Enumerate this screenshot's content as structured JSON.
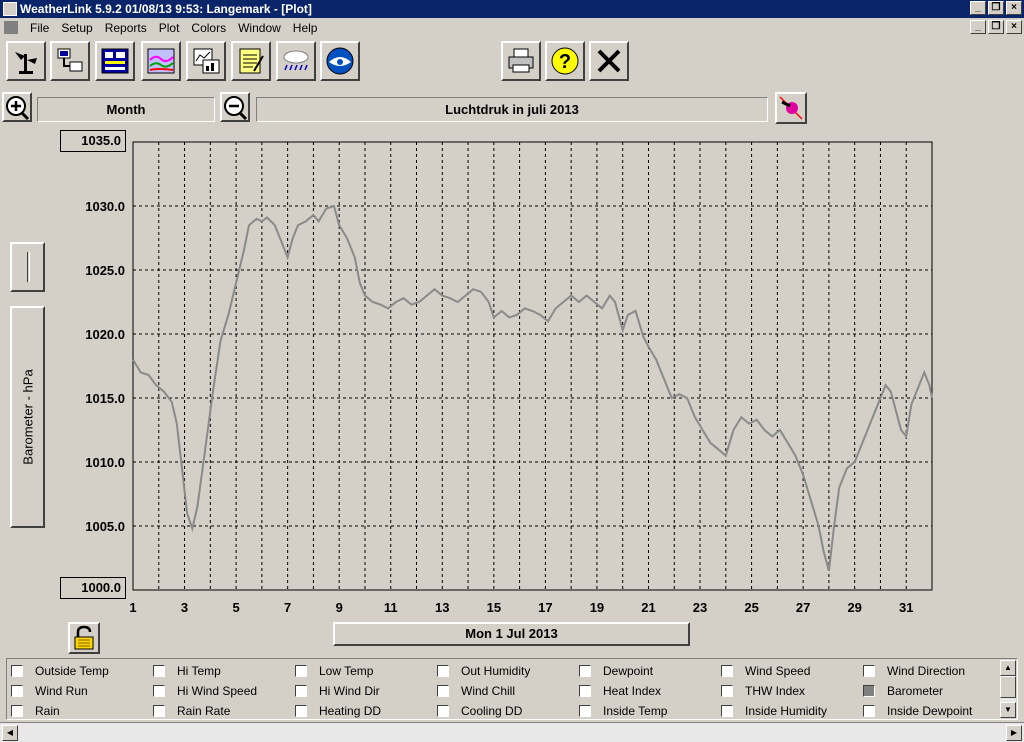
{
  "window": {
    "title": "WeatherLink 5.9.2  01/08/13  9:53: Langemark - [Plot]",
    "colors": {
      "titlebar": "#0a246a",
      "chrome": "#d4d0c8",
      "plot_line": "#8a8a8a"
    }
  },
  "menu": {
    "items": [
      "File",
      "Setup",
      "Reports",
      "Plot",
      "Colors",
      "Window",
      "Help"
    ]
  },
  "toolbar": {
    "icons": [
      "station-icon",
      "connect-icon",
      "bulletin-icon",
      "graph-icon",
      "plot-icon",
      "notes-icon",
      "weather-icon",
      "noaa-icon",
      "printer-icon",
      "help-icon",
      "close-icon"
    ]
  },
  "plot": {
    "zoom_period": "Month",
    "title": "Luchtdruk in juli 2013",
    "y_axis_label": "Barometer - hPa",
    "date_label": "Mon 1 Jul 2013"
  },
  "chart_data": {
    "type": "line",
    "title": "Luchtdruk in juli 2013",
    "xlabel": "",
    "ylabel": "Barometer - hPa",
    "ylim": [
      1000,
      1035
    ],
    "xlim": [
      1,
      32
    ],
    "y_ticks": [
      "1035.0",
      "1030.0",
      "1025.0",
      "1020.0",
      "1015.0",
      "1010.0",
      "1005.0",
      "1000.0"
    ],
    "x_ticks": [
      "1",
      "3",
      "5",
      "7",
      "9",
      "11",
      "13",
      "15",
      "17",
      "19",
      "21",
      "23",
      "25",
      "27",
      "29",
      "31"
    ],
    "grid": true,
    "series": [
      {
        "values": [
          [
            1.0,
            1018.0
          ],
          [
            1.3,
            1017.0
          ],
          [
            1.6,
            1016.8
          ],
          [
            1.9,
            1016.0
          ],
          [
            2.2,
            1015.5
          ],
          [
            2.5,
            1014.7
          ],
          [
            2.7,
            1013.0
          ],
          [
            2.9,
            1009.5
          ],
          [
            3.1,
            1006.0
          ],
          [
            3.3,
            1004.8
          ],
          [
            3.5,
            1006.5
          ],
          [
            3.8,
            1011.0
          ],
          [
            4.1,
            1015.5
          ],
          [
            4.4,
            1019.5
          ],
          [
            4.7,
            1021.5
          ],
          [
            5.0,
            1024.0
          ],
          [
            5.3,
            1026.5
          ],
          [
            5.5,
            1028.5
          ],
          [
            5.8,
            1029.0
          ],
          [
            6.0,
            1028.8
          ],
          [
            6.2,
            1029.1
          ],
          [
            6.5,
            1028.5
          ],
          [
            6.8,
            1027.0
          ],
          [
            7.0,
            1026.0
          ],
          [
            7.2,
            1027.5
          ],
          [
            7.4,
            1028.5
          ],
          [
            7.7,
            1028.8
          ],
          [
            8.0,
            1029.3
          ],
          [
            8.2,
            1028.8
          ],
          [
            8.5,
            1029.8
          ],
          [
            8.8,
            1030.0
          ],
          [
            9.0,
            1028.5
          ],
          [
            9.3,
            1027.5
          ],
          [
            9.6,
            1026.0
          ],
          [
            9.8,
            1024.0
          ],
          [
            10.0,
            1023.0
          ],
          [
            10.3,
            1022.5
          ],
          [
            10.6,
            1022.3
          ],
          [
            10.9,
            1022.0
          ],
          [
            11.2,
            1022.5
          ],
          [
            11.5,
            1022.8
          ],
          [
            11.8,
            1022.3
          ],
          [
            12.1,
            1022.5
          ],
          [
            12.4,
            1023.0
          ],
          [
            12.7,
            1023.5
          ],
          [
            13.0,
            1023.0
          ],
          [
            13.3,
            1022.8
          ],
          [
            13.6,
            1022.5
          ],
          [
            13.9,
            1023.0
          ],
          [
            14.2,
            1023.5
          ],
          [
            14.5,
            1023.3
          ],
          [
            14.8,
            1022.5
          ],
          [
            15.0,
            1021.3
          ],
          [
            15.3,
            1021.8
          ],
          [
            15.6,
            1021.3
          ],
          [
            15.9,
            1021.5
          ],
          [
            16.2,
            1022.0
          ],
          [
            16.5,
            1021.8
          ],
          [
            16.8,
            1021.5
          ],
          [
            17.1,
            1021.0
          ],
          [
            17.4,
            1022.0
          ],
          [
            17.7,
            1022.5
          ],
          [
            18.0,
            1023.0
          ],
          [
            18.3,
            1022.5
          ],
          [
            18.6,
            1023.0
          ],
          [
            18.9,
            1022.5
          ],
          [
            19.2,
            1022.0
          ],
          [
            19.5,
            1023.0
          ],
          [
            19.7,
            1022.5
          ],
          [
            20.0,
            1020.3
          ],
          [
            20.2,
            1021.5
          ],
          [
            20.5,
            1021.8
          ],
          [
            20.8,
            1019.8
          ],
          [
            21.0,
            1019.0
          ],
          [
            21.3,
            1018.0
          ],
          [
            21.6,
            1016.5
          ],
          [
            21.9,
            1015.0
          ],
          [
            22.2,
            1015.3
          ],
          [
            22.5,
            1015.0
          ],
          [
            22.8,
            1013.5
          ],
          [
            23.1,
            1012.5
          ],
          [
            23.4,
            1011.5
          ],
          [
            23.7,
            1011.0
          ],
          [
            24.0,
            1010.5
          ],
          [
            24.3,
            1012.5
          ],
          [
            24.6,
            1013.5
          ],
          [
            24.9,
            1013.0
          ],
          [
            25.2,
            1013.3
          ],
          [
            25.5,
            1012.5
          ],
          [
            25.8,
            1012.0
          ],
          [
            26.1,
            1012.5
          ],
          [
            26.4,
            1011.5
          ],
          [
            26.7,
            1010.5
          ],
          [
            27.0,
            1009.0
          ],
          [
            27.3,
            1007.0
          ],
          [
            27.6,
            1005.0
          ],
          [
            27.8,
            1003.0
          ],
          [
            28.0,
            1001.5
          ],
          [
            28.2,
            1005.0
          ],
          [
            28.4,
            1008.0
          ],
          [
            28.7,
            1009.5
          ],
          [
            29.0,
            1010.0
          ],
          [
            29.3,
            1011.5
          ],
          [
            29.6,
            1013.0
          ],
          [
            29.9,
            1014.5
          ],
          [
            30.2,
            1016.0
          ],
          [
            30.4,
            1015.5
          ],
          [
            30.6,
            1014.0
          ],
          [
            30.8,
            1012.5
          ],
          [
            31.0,
            1012.0
          ],
          [
            31.2,
            1014.5
          ],
          [
            31.5,
            1016.0
          ],
          [
            31.7,
            1017.0
          ],
          [
            31.9,
            1016.0
          ],
          [
            32.0,
            1015.0
          ]
        ]
      }
    ]
  },
  "legend": {
    "items": [
      {
        "label": "Outside Temp",
        "checked": false
      },
      {
        "label": "Hi Temp",
        "checked": false
      },
      {
        "label": "Low Temp",
        "checked": false
      },
      {
        "label": "Out Humidity",
        "checked": false
      },
      {
        "label": "Dewpoint",
        "checked": false
      },
      {
        "label": "Wind Speed",
        "checked": false
      },
      {
        "label": "Wind Direction",
        "checked": false
      },
      {
        "label": "Wind Run",
        "checked": false
      },
      {
        "label": "Hi Wind Speed",
        "checked": false
      },
      {
        "label": "Hi Wind Dir",
        "checked": false
      },
      {
        "label": "Wind Chill",
        "checked": false
      },
      {
        "label": "Heat Index",
        "checked": false
      },
      {
        "label": "THW Index",
        "checked": false
      },
      {
        "label": "Barometer",
        "checked": true
      },
      {
        "label": "Rain",
        "checked": false
      },
      {
        "label": "Rain Rate",
        "checked": false
      },
      {
        "label": "Heating DD",
        "checked": false
      },
      {
        "label": "Cooling DD",
        "checked": false
      },
      {
        "label": "Inside Temp",
        "checked": false
      },
      {
        "label": "Inside Humidity",
        "checked": false
      },
      {
        "label": "Inside Dewpoint",
        "checked": false
      }
    ]
  }
}
